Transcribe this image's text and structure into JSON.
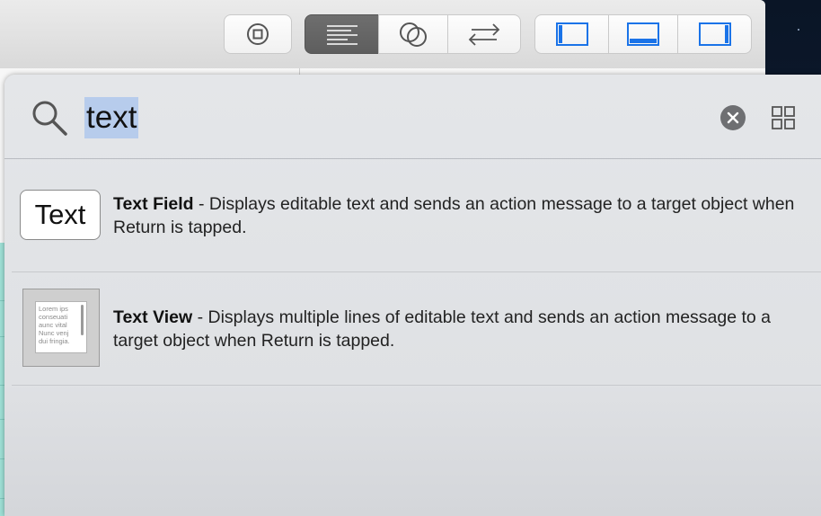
{
  "search": {
    "query": "text"
  },
  "results": [
    {
      "title": "Text Field",
      "separator": " - ",
      "description": "Displays editable text and sends an action message to a target object when Return is tapped.",
      "thumbnail_text": "Text"
    },
    {
      "title": "Text View",
      "separator": " - ",
      "description": "Displays multiple lines of editable text and sends an action message to a target object when Return is tapped.",
      "thumbnail_lines": [
        "Lorem ips",
        "conseuati",
        "aunc vital",
        "Nunc venj",
        "dui fringia."
      ]
    }
  ],
  "colors": {
    "selection": "#b7ccec",
    "accent": "#1a73e8",
    "teal": "#9fe0d6"
  },
  "icons": {
    "stop": "stop-icon",
    "editor": "align-left-icon",
    "assistant": "venn-circles-icon",
    "version": "swap-arrows-icon",
    "navigator": "left-panel-icon",
    "debug": "bottom-panel-icon",
    "inspector": "right-panel-icon",
    "search": "magnifier-icon",
    "clear": "clear-icon",
    "grid": "grid-icon"
  }
}
